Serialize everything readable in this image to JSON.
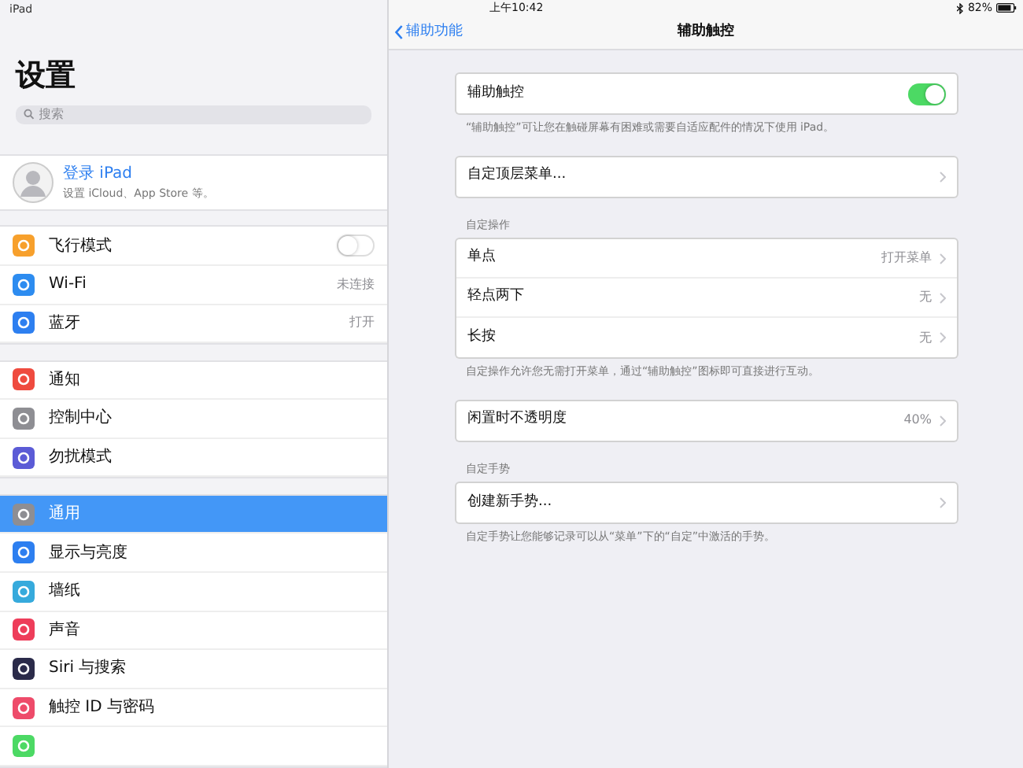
{
  "status_bar": {
    "device": "iPad",
    "time": "上午10:42",
    "battery_percent": "82%"
  },
  "sidebar": {
    "title": "设置",
    "search": {
      "placeholder": "搜索"
    },
    "profile": {
      "name": "登录 iPad",
      "subtitle": "设置 iCloud、App Store 等。"
    },
    "groups": [
      [
        {
          "kind": "toggle",
          "label": "飞行模式",
          "on": false,
          "color": "#f7a02c",
          "selected": false
        },
        {
          "kind": "value",
          "label": "Wi-Fi",
          "value": "未连接",
          "color": "#2d8cf0",
          "selected": false
        },
        {
          "kind": "value",
          "label": "蓝牙",
          "value": "打开",
          "color": "#2d7ff0",
          "selected": false
        }
      ],
      [
        {
          "kind": "plain",
          "label": "通知",
          "color": "#ef4b3f",
          "selected": false
        },
        {
          "kind": "plain",
          "label": "控制中心",
          "color": "#8e8e93",
          "selected": false
        },
        {
          "kind": "plain",
          "label": "勿扰模式",
          "color": "#5b5bd6",
          "selected": false
        }
      ],
      [
        {
          "kind": "plain",
          "label": "通用",
          "color": "#8e8e93",
          "selected": true
        },
        {
          "kind": "plain",
          "label": "显示与亮度",
          "color": "#2d7ff0",
          "selected": false
        },
        {
          "kind": "plain",
          "label": "墙纸",
          "color": "#36aadc",
          "selected": false
        },
        {
          "kind": "plain",
          "label": "声音",
          "color": "#ee3d5a",
          "selected": false
        },
        {
          "kind": "plain",
          "label": "Siri 与搜索",
          "color": "#2b2b4a",
          "selected": false
        },
        {
          "kind": "plain",
          "label": "触控 ID 与密码",
          "color": "#ee4b6a",
          "selected": false
        },
        {
          "kind": "plain",
          "color": "#4cd964",
          "selected": false
        }
      ]
    ]
  },
  "detail": {
    "back": "辅助功能",
    "title": "辅助触控",
    "sections": [
      {
        "rows": [
          {
            "kind": "toggle",
            "label": "辅助触控",
            "on": true
          }
        ],
        "footer": "“辅助触控”可让您在触碰屏幕有困难或需要自适应配件的情况下使用 iPad。"
      },
      {
        "rows": [
          {
            "kind": "link",
            "label": "自定顶层菜单..."
          }
        ]
      },
      {
        "header": "自定操作",
        "rows": [
          {
            "kind": "link",
            "label": "单点",
            "value": "打开菜单"
          },
          {
            "kind": "link",
            "label": "轻点两下",
            "value": "无"
          },
          {
            "kind": "link",
            "label": "长按",
            "value": "无"
          }
        ],
        "footer": "自定操作允许您无需打开菜单，通过“辅助触控”图标即可直接进行互动。"
      },
      {
        "rows": [
          {
            "kind": "link",
            "label": "闲置时不透明度",
            "value": "40%"
          }
        ]
      },
      {
        "header": "自定手势",
        "rows": [
          {
            "kind": "link",
            "label": "创建新手势..."
          }
        ],
        "footer": "自定手势让您能够记录可以从“菜单”下的“自定”中激活的手势。"
      }
    ]
  }
}
